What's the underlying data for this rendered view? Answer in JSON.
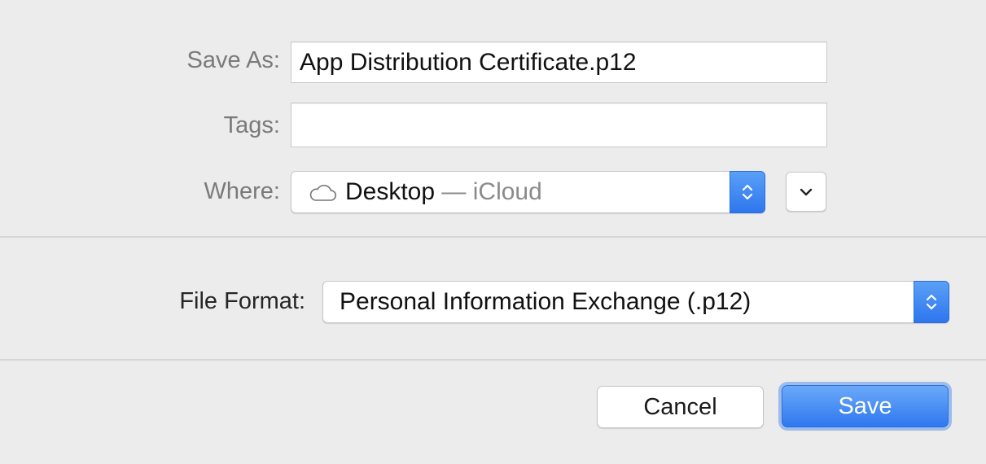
{
  "save_as": {
    "label": "Save As:",
    "value": "App Distribution Certificate.p12"
  },
  "tags": {
    "label": "Tags:",
    "value": ""
  },
  "where": {
    "label": "Where:",
    "location": "Desktop",
    "separator": " — ",
    "service": "iCloud",
    "icon": "cloud-icon",
    "expand_icon": "chevron-down-icon"
  },
  "file_format": {
    "label": "File Format:",
    "value": "Personal Information Exchange (.p12)"
  },
  "buttons": {
    "cancel": "Cancel",
    "save": "Save"
  },
  "colors": {
    "accent": "#2f78ef",
    "background": "#ececec"
  }
}
